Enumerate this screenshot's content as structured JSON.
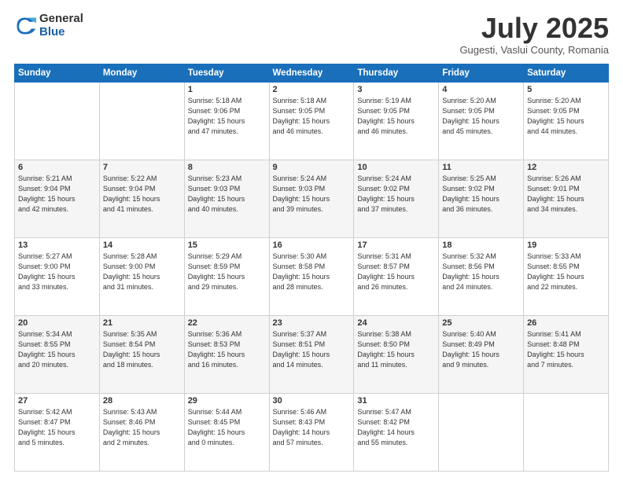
{
  "header": {
    "logo_general": "General",
    "logo_blue": "Blue",
    "month_title": "July 2025",
    "location": "Gugesti, Vaslui County, Romania"
  },
  "calendar": {
    "days_of_week": [
      "Sunday",
      "Monday",
      "Tuesday",
      "Wednesday",
      "Thursday",
      "Friday",
      "Saturday"
    ],
    "weeks": [
      [
        {
          "day": "",
          "info": ""
        },
        {
          "day": "",
          "info": ""
        },
        {
          "day": "1",
          "info": "Sunrise: 5:18 AM\nSunset: 9:06 PM\nDaylight: 15 hours\nand 47 minutes."
        },
        {
          "day": "2",
          "info": "Sunrise: 5:18 AM\nSunset: 9:05 PM\nDaylight: 15 hours\nand 46 minutes."
        },
        {
          "day": "3",
          "info": "Sunrise: 5:19 AM\nSunset: 9:05 PM\nDaylight: 15 hours\nand 46 minutes."
        },
        {
          "day": "4",
          "info": "Sunrise: 5:20 AM\nSunset: 9:05 PM\nDaylight: 15 hours\nand 45 minutes."
        },
        {
          "day": "5",
          "info": "Sunrise: 5:20 AM\nSunset: 9:05 PM\nDaylight: 15 hours\nand 44 minutes."
        }
      ],
      [
        {
          "day": "6",
          "info": "Sunrise: 5:21 AM\nSunset: 9:04 PM\nDaylight: 15 hours\nand 42 minutes."
        },
        {
          "day": "7",
          "info": "Sunrise: 5:22 AM\nSunset: 9:04 PM\nDaylight: 15 hours\nand 41 minutes."
        },
        {
          "day": "8",
          "info": "Sunrise: 5:23 AM\nSunset: 9:03 PM\nDaylight: 15 hours\nand 40 minutes."
        },
        {
          "day": "9",
          "info": "Sunrise: 5:24 AM\nSunset: 9:03 PM\nDaylight: 15 hours\nand 39 minutes."
        },
        {
          "day": "10",
          "info": "Sunrise: 5:24 AM\nSunset: 9:02 PM\nDaylight: 15 hours\nand 37 minutes."
        },
        {
          "day": "11",
          "info": "Sunrise: 5:25 AM\nSunset: 9:02 PM\nDaylight: 15 hours\nand 36 minutes."
        },
        {
          "day": "12",
          "info": "Sunrise: 5:26 AM\nSunset: 9:01 PM\nDaylight: 15 hours\nand 34 minutes."
        }
      ],
      [
        {
          "day": "13",
          "info": "Sunrise: 5:27 AM\nSunset: 9:00 PM\nDaylight: 15 hours\nand 33 minutes."
        },
        {
          "day": "14",
          "info": "Sunrise: 5:28 AM\nSunset: 9:00 PM\nDaylight: 15 hours\nand 31 minutes."
        },
        {
          "day": "15",
          "info": "Sunrise: 5:29 AM\nSunset: 8:59 PM\nDaylight: 15 hours\nand 29 minutes."
        },
        {
          "day": "16",
          "info": "Sunrise: 5:30 AM\nSunset: 8:58 PM\nDaylight: 15 hours\nand 28 minutes."
        },
        {
          "day": "17",
          "info": "Sunrise: 5:31 AM\nSunset: 8:57 PM\nDaylight: 15 hours\nand 26 minutes."
        },
        {
          "day": "18",
          "info": "Sunrise: 5:32 AM\nSunset: 8:56 PM\nDaylight: 15 hours\nand 24 minutes."
        },
        {
          "day": "19",
          "info": "Sunrise: 5:33 AM\nSunset: 8:55 PM\nDaylight: 15 hours\nand 22 minutes."
        }
      ],
      [
        {
          "day": "20",
          "info": "Sunrise: 5:34 AM\nSunset: 8:55 PM\nDaylight: 15 hours\nand 20 minutes."
        },
        {
          "day": "21",
          "info": "Sunrise: 5:35 AM\nSunset: 8:54 PM\nDaylight: 15 hours\nand 18 minutes."
        },
        {
          "day": "22",
          "info": "Sunrise: 5:36 AM\nSunset: 8:53 PM\nDaylight: 15 hours\nand 16 minutes."
        },
        {
          "day": "23",
          "info": "Sunrise: 5:37 AM\nSunset: 8:51 PM\nDaylight: 15 hours\nand 14 minutes."
        },
        {
          "day": "24",
          "info": "Sunrise: 5:38 AM\nSunset: 8:50 PM\nDaylight: 15 hours\nand 11 minutes."
        },
        {
          "day": "25",
          "info": "Sunrise: 5:40 AM\nSunset: 8:49 PM\nDaylight: 15 hours\nand 9 minutes."
        },
        {
          "day": "26",
          "info": "Sunrise: 5:41 AM\nSunset: 8:48 PM\nDaylight: 15 hours\nand 7 minutes."
        }
      ],
      [
        {
          "day": "27",
          "info": "Sunrise: 5:42 AM\nSunset: 8:47 PM\nDaylight: 15 hours\nand 5 minutes."
        },
        {
          "day": "28",
          "info": "Sunrise: 5:43 AM\nSunset: 8:46 PM\nDaylight: 15 hours\nand 2 minutes."
        },
        {
          "day": "29",
          "info": "Sunrise: 5:44 AM\nSunset: 8:45 PM\nDaylight: 15 hours\nand 0 minutes."
        },
        {
          "day": "30",
          "info": "Sunrise: 5:46 AM\nSunset: 8:43 PM\nDaylight: 14 hours\nand 57 minutes."
        },
        {
          "day": "31",
          "info": "Sunrise: 5:47 AM\nSunset: 8:42 PM\nDaylight: 14 hours\nand 55 minutes."
        },
        {
          "day": "",
          "info": ""
        },
        {
          "day": "",
          "info": ""
        }
      ]
    ]
  }
}
